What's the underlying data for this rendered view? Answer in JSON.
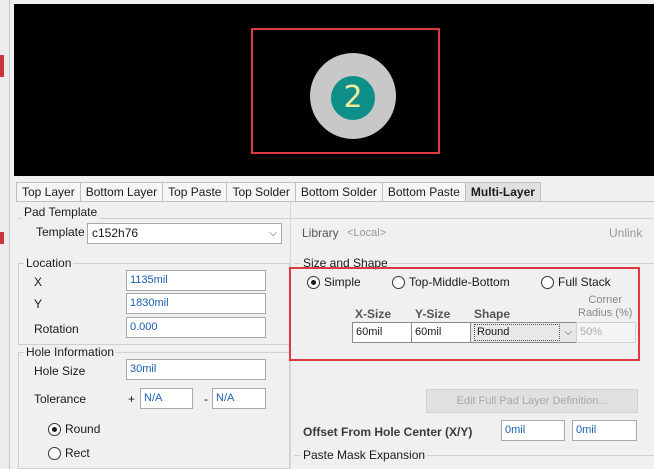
{
  "tabs": [
    "Top Layer",
    "Bottom Layer",
    "Top Paste",
    "Top Solder",
    "Bottom Solder",
    "Bottom Paste",
    "Multi-Layer"
  ],
  "active_tab": "Multi-Layer",
  "preview": {
    "pad_number": "2",
    "outer_color": "#c8c8c8",
    "inner_color": "#0e8f8a",
    "number_color": "#f2eb9a",
    "highlight_color": "#e0383e"
  },
  "pad_template": {
    "title": "Pad Template",
    "template_label": "Template",
    "template_value": "c152h76",
    "library_label": "Library",
    "library_value": "<Local>",
    "unlink_label": "Unlink"
  },
  "location": {
    "title": "Location",
    "x_label": "X",
    "x_value": "1135mil",
    "y_label": "Y",
    "y_value": "1830mil",
    "rotation_label": "Rotation",
    "rotation_value": "0.000"
  },
  "hole": {
    "title": "Hole Information",
    "size_label": "Hole Size",
    "size_value": "30mil",
    "tolerance_label": "Tolerance",
    "plus": "+",
    "plus_value": "N/A",
    "minus": "-",
    "minus_value": "N/A",
    "shape_round": "Round",
    "shape_rect": "Rect",
    "selected_shape": "Round"
  },
  "size_shape": {
    "title": "Size and Shape",
    "options": [
      "Simple",
      "Top-Middle-Bottom",
      "Full Stack"
    ],
    "selected": "Simple",
    "col_xsize": "X-Size",
    "col_ysize": "Y-Size",
    "col_shape": "Shape",
    "col_corner": "Corner\nRadius (%)",
    "xsize": "60mil",
    "ysize": "60mil",
    "shape": "Round",
    "corner": "50%"
  },
  "edit_full_pad_button": "Edit Full Pad Layer Definition...",
  "offset": {
    "label": "Offset From Hole Center (X/Y)",
    "x_value": "0mil",
    "y_value": "0mil"
  },
  "paste_mask": {
    "title": "Paste Mask Expansion"
  }
}
